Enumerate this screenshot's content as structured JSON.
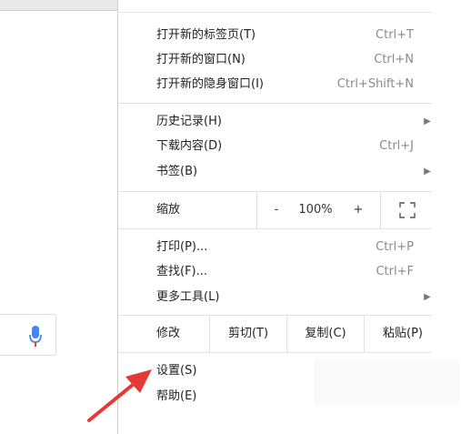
{
  "menu": {
    "new_tab": {
      "label": "打开新的标签页(T)",
      "shortcut": "Ctrl+T"
    },
    "new_window": {
      "label": "打开新的窗口(N)",
      "shortcut": "Ctrl+N"
    },
    "new_incognito": {
      "label": "打开新的隐身窗口(I)",
      "shortcut": "Ctrl+Shift+N"
    },
    "history": {
      "label": "历史记录(H)"
    },
    "downloads": {
      "label": "下载内容(D)",
      "shortcut": "Ctrl+J"
    },
    "bookmarks": {
      "label": "书签(B)"
    },
    "zoom": {
      "label": "缩放",
      "minus": "-",
      "level": "100%",
      "plus": "+"
    },
    "print": {
      "label": "打印(P)...",
      "shortcut": "Ctrl+P"
    },
    "find": {
      "label": "查找(F)...",
      "shortcut": "Ctrl+F"
    },
    "more_tools": {
      "label": "更多工具(L)"
    },
    "edit": {
      "label": "修改",
      "cut": "剪切(T)",
      "copy": "复制(C)",
      "paste": "粘贴(P)"
    },
    "settings": {
      "label": "设置(S)"
    },
    "help": {
      "label": "帮助(E)"
    }
  },
  "icons": {
    "submenu": "chevron-right-icon",
    "mic": "microphone-icon",
    "fullscreen": "fullscreen-icon",
    "annotation": "red-arrow"
  },
  "colors": {
    "mic_blue": "#4285f4",
    "mic_red": "#ea4335",
    "annotation_red": "#e53935"
  }
}
